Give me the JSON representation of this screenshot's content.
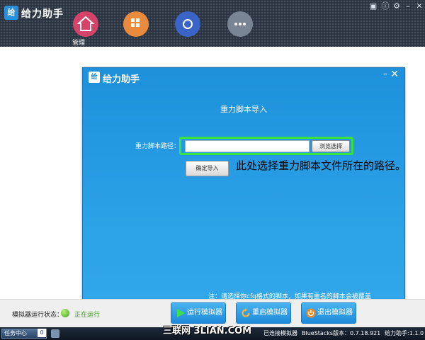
{
  "app": {
    "title": "给力助手",
    "logo_text": "给"
  },
  "nav": {
    "first_label": "管理"
  },
  "dialog": {
    "brand": "给力助手",
    "title": "重力脚本导入",
    "path_label": "重力脚本路径：",
    "path_value": "",
    "browse_label": "浏览选择",
    "confirm_label": "确定导入",
    "annotation": "此处选择重力脚本文件所在的路径。",
    "note": "注：请选择你cfg格式的脚本，如果有重名的脚本会被覆盖"
  },
  "status": {
    "label": "模拟器运行状态：",
    "value": "正在运行",
    "value_color": "#3a9a1a"
  },
  "actions": {
    "run": "运行模拟器",
    "restart": "重启模拟器",
    "exit": "退出模拟器"
  },
  "taskbar": {
    "task_center": "任务中心",
    "task_count": "0",
    "connected": "已连接模拟器",
    "bluestacks_version": "BlueStacks版本：0.7.18.921",
    "app_version": "给力助手:1.1.0",
    "watermark": "三联网 3LIAN.COM"
  },
  "colors": {
    "dialog_blue": "#2aa0e6",
    "highlight_green": "#39e23c",
    "topbar_dark": "#2b3440"
  }
}
